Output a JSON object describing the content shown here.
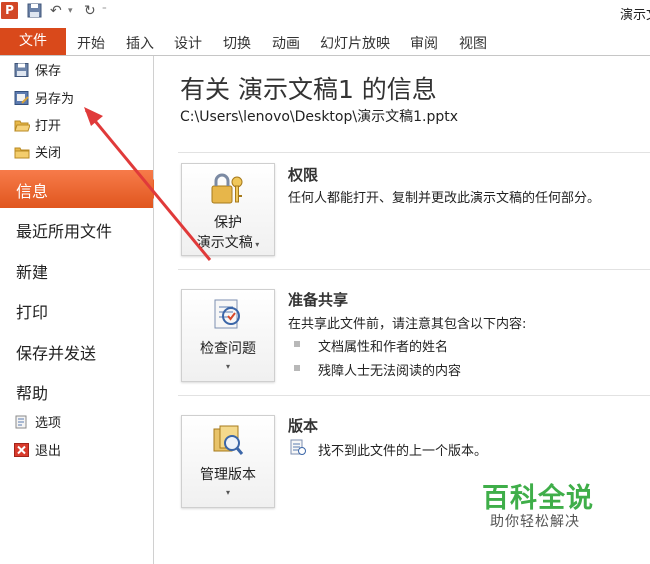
{
  "window": {
    "title": "演示文"
  },
  "qat": {
    "save_icon": "save-icon",
    "undo_icon": "undo-icon",
    "redo_icon": "redo-icon"
  },
  "ribbon": {
    "file_tab": "文件",
    "tabs": [
      "开始",
      "插入",
      "设计",
      "切换",
      "动画",
      "幻灯片放映",
      "审阅",
      "视图"
    ]
  },
  "sidebar": {
    "commands": [
      {
        "label": "保存",
        "icon": "save-icon"
      },
      {
        "label": "另存为",
        "icon": "save-as-icon"
      },
      {
        "label": "打开",
        "icon": "open-folder-icon"
      },
      {
        "label": "关闭",
        "icon": "close-folder-icon"
      }
    ],
    "nav": [
      "信息",
      "最近所用文件",
      "新建",
      "打印",
      "保存并发送",
      "帮助"
    ],
    "active_nav": "信息",
    "bottom_commands": [
      {
        "label": "选项",
        "icon": "options-icon"
      },
      {
        "label": "退出",
        "icon": "exit-icon"
      }
    ]
  },
  "info": {
    "title": "有关 演示文稿1 的信息",
    "path": "C:\\Users\\lenovo\\Desktop\\演示文稿1.pptx",
    "sections": [
      {
        "button_line1": "保护",
        "button_line2": "演示文稿",
        "heading": "权限",
        "text": "任何人都能打开、复制并更改此演示文稿的任何部分。"
      },
      {
        "button_line1": "检查问题",
        "heading": "准备共享",
        "text": "在共享此文件前，请注意其包含以下内容:",
        "bullets": [
          "文档属性和作者的姓名",
          "残障人士无法阅读的内容"
        ]
      },
      {
        "button_line1": "管理版本",
        "heading": "版本",
        "text": "找不到此文件的上一个版本。"
      }
    ]
  },
  "watermark": {
    "title": "百科全说",
    "subtitle": "助你轻松解决"
  },
  "colors": {
    "accent": "#d9491b",
    "active_nav": "#f06a36",
    "watermark_green": "#3fae49",
    "annotation_red": "#e03a3a"
  }
}
